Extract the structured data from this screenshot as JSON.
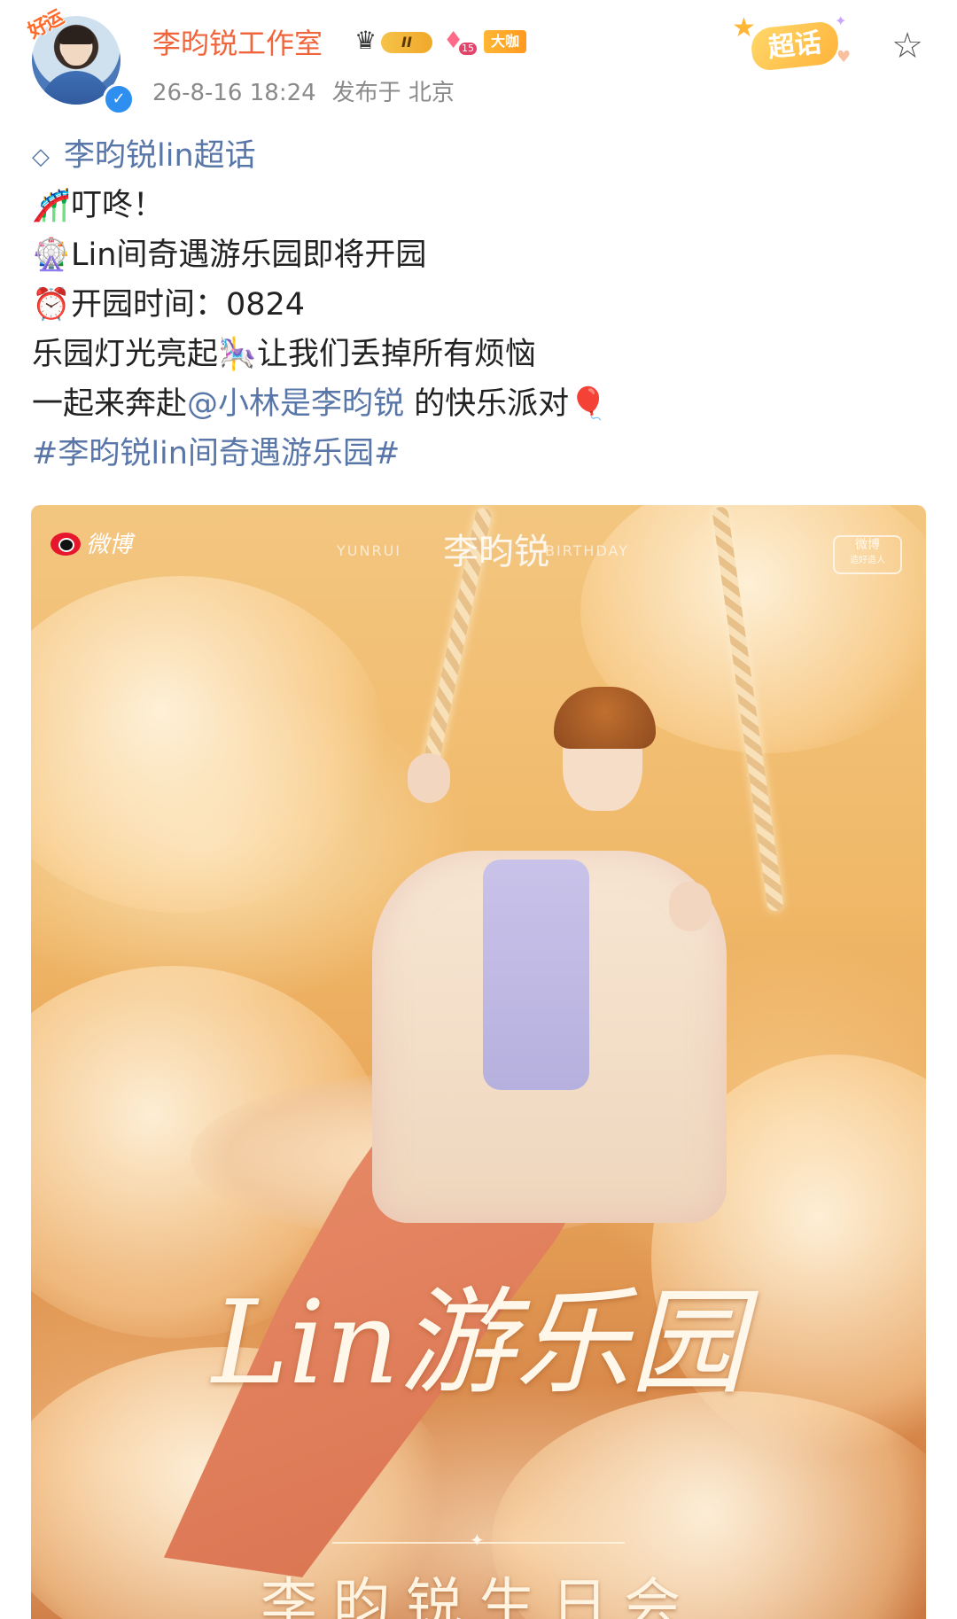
{
  "header": {
    "avatar_badge": "好运",
    "username": "李昀锐工作室",
    "level_badge": "II",
    "gem_level": "15",
    "vip_badge": "大咖",
    "timestamp": "26-8-16 18:24",
    "published_from": "发布于 北京",
    "supertopic_button": "超话"
  },
  "body": {
    "topic_link": "李昀锐lin超话",
    "line1_emoji": "🎢",
    "line1_text": "叮咚！",
    "line2_emoji": "🎡",
    "line2_text": "Lin间奇遇游乐园即将开园",
    "line3_emoji": "⏰",
    "line3_text": "开园时间：0824",
    "line4_text_a": "乐园灯光亮起",
    "line4_emoji": "🎠",
    "line4_text_b": "让我们丢掉所有烦恼",
    "line5_text_a": "一起来奔赴",
    "line5_mention": "@小林是李昀锐",
    "line5_text_b": " 的快乐派对",
    "line5_emoji": "🎈",
    "hashtag": "#李昀锐lin间奇遇游乐园#"
  },
  "poster": {
    "weibo_logo": "微博",
    "top_left": "YUNRUI",
    "top_name": "李昀锐",
    "top_right": "BIRTHDAY",
    "corner_logo_1": "微博",
    "corner_logo_2": "造好造人",
    "title": "Lin游乐园",
    "subtitle": "李昀锐生日会"
  },
  "colors": {
    "username": "#f0653c",
    "link": "#5876a8",
    "meta": "#8a8a8a"
  },
  "icons": {
    "verified": "verified-check-icon",
    "favorite": "star-outline-icon",
    "topic": "diamond-icon"
  }
}
